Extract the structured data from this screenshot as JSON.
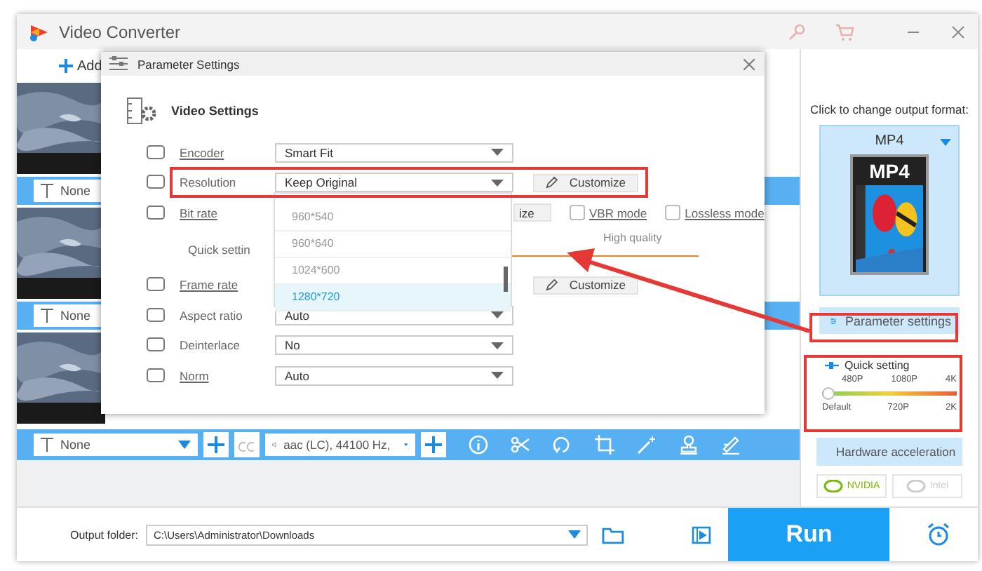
{
  "window": {
    "title": "Video Converter"
  },
  "toolbar": {
    "add_label": "Add"
  },
  "files": [
    {
      "kind": "picture",
      "subtitle": "None"
    },
    {
      "kind": "picture",
      "subtitle": "None"
    },
    {
      "kind": "picture"
    }
  ],
  "dialog": {
    "title": "Parameter Settings",
    "heading": "Video Settings",
    "rows": [
      {
        "kind": "select",
        "label": "Encoder",
        "underlined": true,
        "value": "Smart Fit"
      },
      {
        "kind": "select",
        "label": "Resolution",
        "underlined": false,
        "value": "Keep Original",
        "button": "Customize"
      },
      {
        "kind": "bitrate",
        "label": "Bit rate",
        "underlined": true,
        "button": "ize",
        "checks": [
          {
            "label": "VBR mode",
            "checked": false
          },
          {
            "label": "Lossless mode",
            "checked": false
          }
        ]
      },
      {
        "kind": "quick",
        "label": "Quick settin",
        "hint": "High quality"
      },
      {
        "kind": "hidden",
        "label": "Frame rate",
        "underlined": true,
        "button": "Customize"
      },
      {
        "kind": "select",
        "label": "Aspect ratio",
        "underlined": false,
        "value": "Auto"
      },
      {
        "kind": "select",
        "label": "Deinterlace",
        "underlined": false,
        "value": "No"
      },
      {
        "kind": "select",
        "label": "Norm",
        "underlined": true,
        "value": "Auto"
      }
    ],
    "options": [
      {
        "label": "960*540",
        "selected": false
      },
      {
        "label": "960*640",
        "selected": false
      },
      {
        "label": "1024*600",
        "selected": false
      },
      {
        "label": "1280*720",
        "selected": true
      }
    ]
  },
  "right_panel": {
    "format_hint": "Click to change output format:",
    "format": "MP4",
    "format_badge": "MP4",
    "param_button": "Parameter settings",
    "quick": {
      "title": "Quick setting",
      "top_labels": [
        "480P",
        "1080P",
        "4K"
      ],
      "bottom_labels": [
        "Default",
        "720P",
        "2K"
      ],
      "level": 0
    },
    "hw_button": "Hardware acceleration",
    "gpus": [
      {
        "label": "NVIDIA",
        "enabled": true
      },
      {
        "label": "Intel",
        "enabled": false
      }
    ]
  },
  "bottom_toolbar": {
    "subtitle": "None",
    "audio": "aac (LC), 44100 Hz,"
  },
  "output": {
    "label": "Output folder:",
    "path": "C:\\Users\\Administrator\\Downloads"
  },
  "run_label": "Run"
}
